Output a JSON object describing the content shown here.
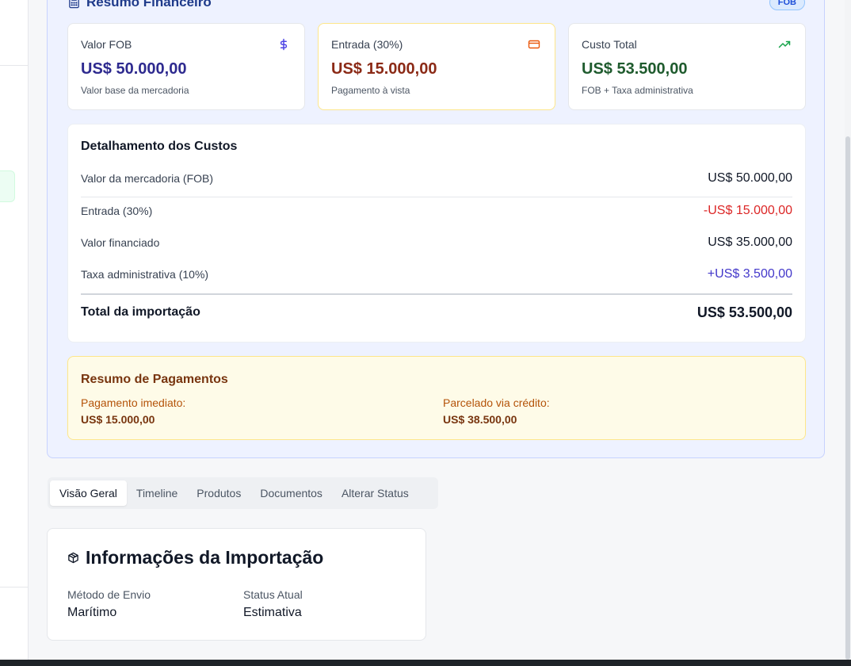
{
  "financial_summary": {
    "title": "Resumo Financeiro",
    "badge": "FOB",
    "cards": [
      {
        "label": "Valor FOB",
        "value": "US$ 50.000,00",
        "subtitle": "Valor base da mercadoria",
        "icon": "dollar-icon",
        "value_color": "#2e2a8f"
      },
      {
        "label": "Entrada (30%)",
        "value": "US$ 15.000,00",
        "subtitle": "Pagamento à vista",
        "icon": "credit-card-icon",
        "value_color": "#8b2a16"
      },
      {
        "label": "Custo Total",
        "value": "US$ 53.500,00",
        "subtitle": "FOB + Taxa administrativa",
        "icon": "trending-up-icon",
        "value_color": "#1f5b2e"
      }
    ],
    "breakdown": {
      "title": "Detalhamento dos Custos",
      "rows": [
        {
          "label": "Valor da mercadoria (FOB)",
          "value": "US$ 50.000,00"
        },
        {
          "label": "Entrada (30%)",
          "value": "-US$ 15.000,00"
        },
        {
          "label": "Valor financiado",
          "value": "US$ 35.000,00"
        },
        {
          "label": "Taxa administrativa (10%)",
          "value": "+US$ 3.500,00"
        }
      ],
      "total_label": "Total da importação",
      "total_value": "US$ 53.500,00"
    },
    "payments": {
      "title": "Resumo de Pagamentos",
      "immediate_label": "Pagamento imediato:",
      "immediate_value": "US$ 15.000,00",
      "credit_label": "Parcelado via crédito:",
      "credit_value": "US$ 38.500,00"
    }
  },
  "tabs": [
    "Visão Geral",
    "Timeline",
    "Produtos",
    "Documentos",
    "Alterar Status"
  ],
  "active_tab": "Visão Geral",
  "import_info": {
    "title": "Informações da Importação",
    "fields": [
      {
        "label": "Método de Envio",
        "value": "Marítimo"
      },
      {
        "label": "Status Atual",
        "value": "Estimativa"
      }
    ]
  },
  "colors": {
    "negative": "#dc2626",
    "positive": "#4338ca",
    "dollar_icon": "#4f46e5",
    "card_icon": "#ea580c",
    "trend_icon": "#16a34a"
  }
}
